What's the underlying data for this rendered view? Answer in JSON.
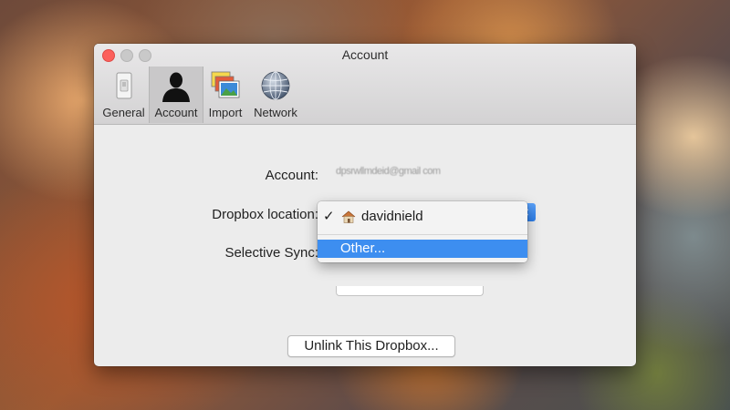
{
  "window": {
    "title": "Account"
  },
  "toolbar": {
    "tabs": [
      {
        "label": "General",
        "icon": "switch-icon"
      },
      {
        "label": "Account",
        "icon": "person-icon",
        "selected": true
      },
      {
        "label": "Import",
        "icon": "photos-icon"
      },
      {
        "label": "Network",
        "icon": "globe-icon"
      }
    ]
  },
  "form": {
    "account_label": "Account:",
    "account_value": "dpsrwllmdeid@gmail com",
    "dropbox_location_label": "Dropbox location:",
    "selective_sync_label": "Selective Sync:",
    "unlink_button": "Unlink This Dropbox...",
    "help_button": "?"
  },
  "location_menu": {
    "items": [
      {
        "label": "davidnield",
        "checked": true,
        "icon": "home-folder-icon",
        "check_mark": "✓"
      },
      {
        "label": "Other...",
        "highlighted": true
      }
    ]
  },
  "colors": {
    "accent": "#3d8ef0",
    "close_button": "#fc605c"
  }
}
